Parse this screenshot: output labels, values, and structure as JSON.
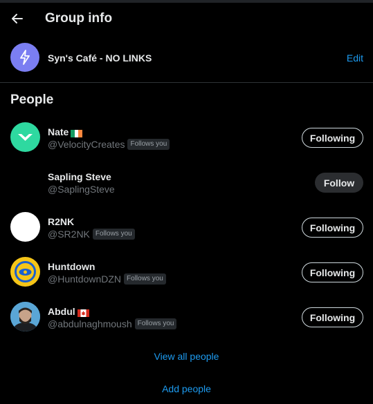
{
  "header": {
    "title": "Group info",
    "back_icon": "back-arrow-icon"
  },
  "group": {
    "name": "Syn's Café - NO LINKS",
    "edit_label": "Edit",
    "avatar_color": "#7b7ef2",
    "avatar_icon": "lightning-bolt-icon"
  },
  "people": {
    "title": "People",
    "members": [
      {
        "name": "Nate",
        "flag": "ireland-flag-icon",
        "handle": "@VelocityCreates",
        "follows_you": "Follows you",
        "button": "Following"
      },
      {
        "name": "Sapling Steve",
        "handle": "@SaplingSteve",
        "follows_you": "",
        "button": "Follow"
      },
      {
        "name": "R2NK",
        "handle": "@SR2NK",
        "follows_you": "Follows you",
        "button": "Following"
      },
      {
        "name": "Huntdown",
        "handle": "@HuntdownDZN",
        "follows_you": "Follows you",
        "button": "Following"
      },
      {
        "name": "Abdul",
        "flag": "canada-flag-icon",
        "handle": "@abdulnaghmoush",
        "follows_you": "Follows you",
        "button": "Following"
      }
    ],
    "view_all": "View all people",
    "add_people": "Add people"
  },
  "colors": {
    "accent": "#1d9bf0",
    "background": "#000000",
    "divider": "#2f3336"
  }
}
